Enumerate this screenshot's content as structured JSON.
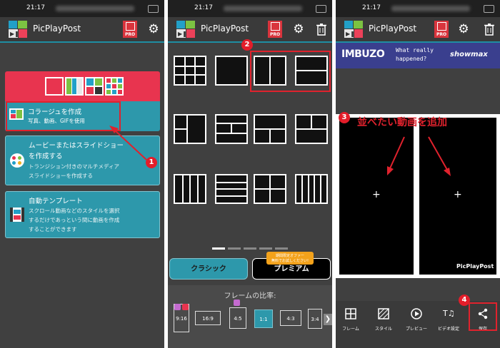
{
  "status_time": "21:17",
  "app_title": "PicPlayPost",
  "pro_label": "PRO",
  "screen1": {
    "card1_title": "コラージュを作成",
    "card1_sub": "写真、動画、GIFを使用",
    "card2_title_l1": "ムービーまたはスライドショー",
    "card2_title_l2": "を作成する",
    "card2_sub_l1": "トランジション付きのマルチメディア",
    "card2_sub_l2": "スライドショーを作成する",
    "card3_title": "自動テンプレート",
    "card3_sub_l1": "スクロール動画などのスタイルを選択",
    "card3_sub_l2": "するだけであっという間に動画を作成",
    "card3_sub_l3": "することができます",
    "badge": "1"
  },
  "screen2": {
    "badge": "2",
    "tab_classic": "クラシック",
    "tab_premium": "プレミアム",
    "promo_l1": "期間限定オファー",
    "promo_l2": "無料でお試しください!",
    "ratio_label": "フレームの比率:",
    "ratios": [
      "9:16",
      "16:9",
      "4:5",
      "1:1",
      "4:3",
      "3:4"
    ]
  },
  "screen3": {
    "ad_brand": "IMBUZO",
    "ad_text_l1": "What really",
    "ad_text_l2": "happened?",
    "ad_show": "showmax",
    "badge3": "3",
    "annotation": "並べたい動画を追加",
    "plus": "+",
    "watermark": "PicPlayPost",
    "badge4": "4",
    "tools": [
      "フレーム",
      "スタイル",
      "プレビュー",
      "ビデオ設定",
      "保存"
    ]
  },
  "colors": {
    "accent": "#2d98ab",
    "red": "#e0222d",
    "pink": "#e8344f"
  }
}
